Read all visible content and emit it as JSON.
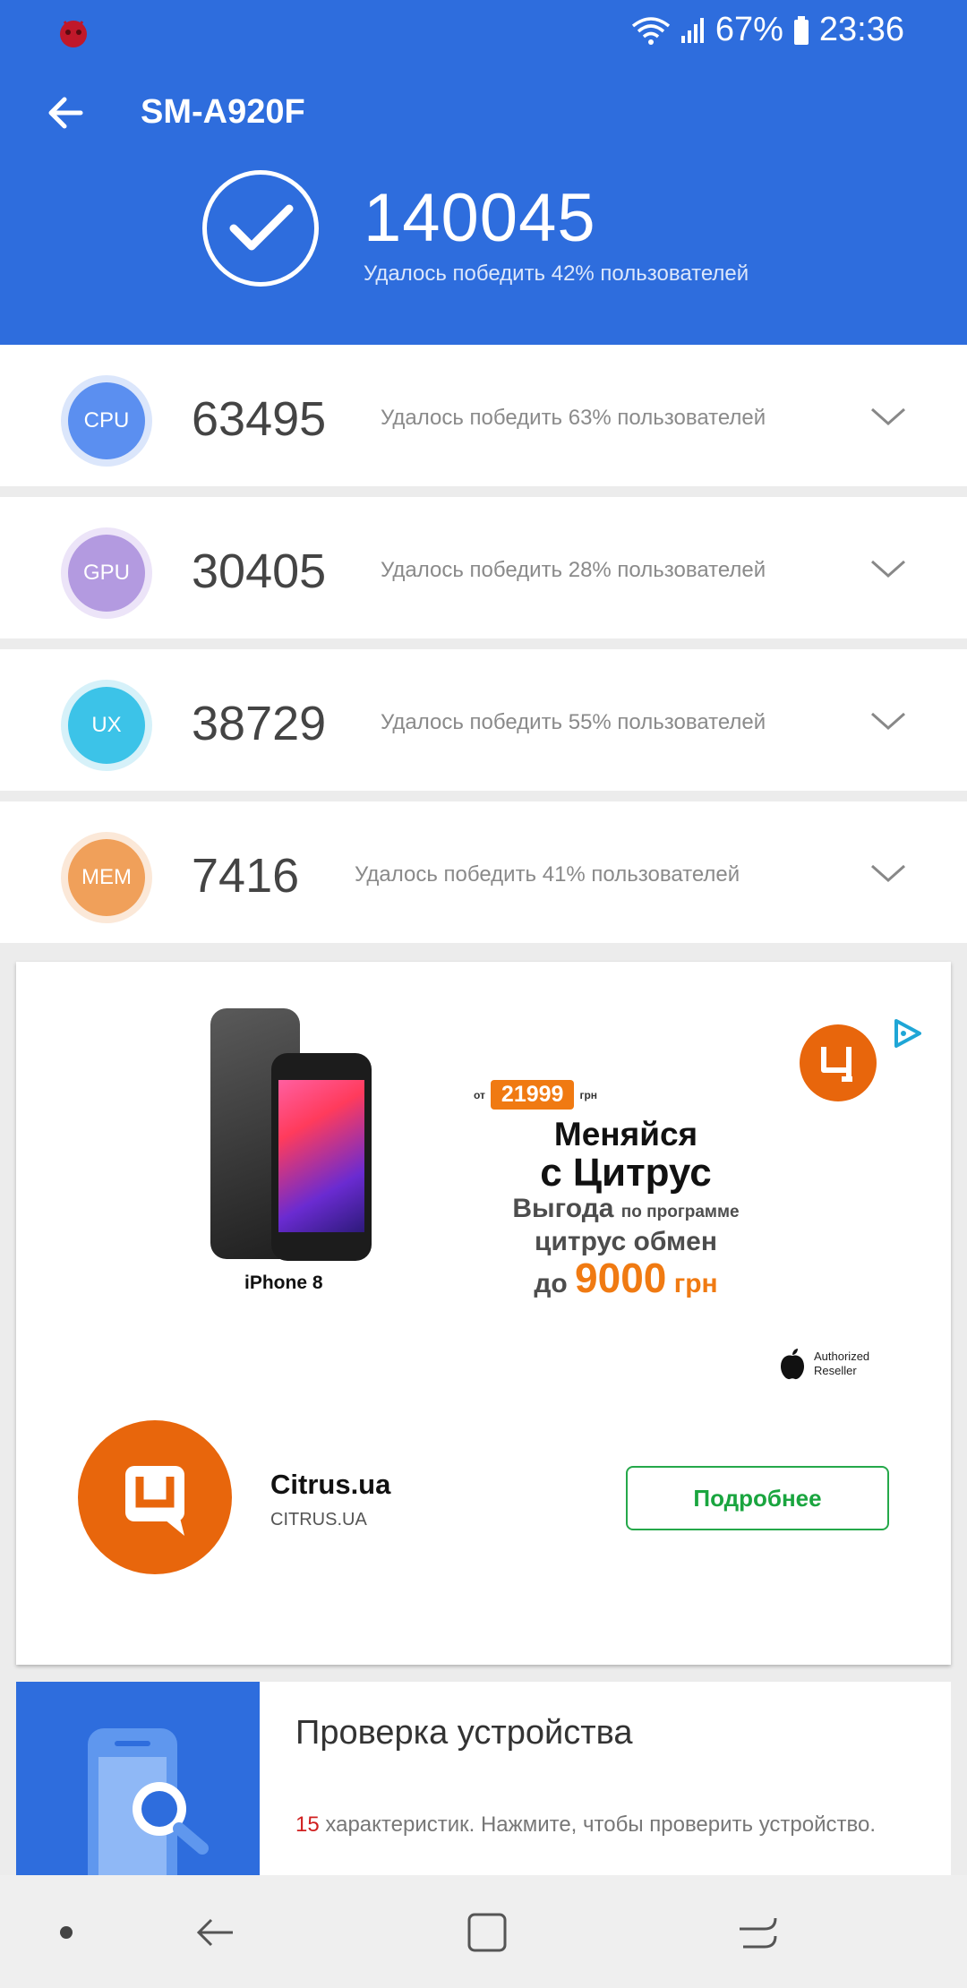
{
  "status_bar": {
    "battery": "67%",
    "time": "23:36"
  },
  "header": {
    "device_name": "SM-A920F",
    "total_score": "140045",
    "total_description": "Удалось победить 42% пользователей"
  },
  "scores": [
    {
      "badge": "CPU",
      "score": "63495",
      "description": "Удалось победить 63% пользователей",
      "color": "#5b8ff0"
    },
    {
      "badge": "GPU",
      "score": "30405",
      "description": "Удалось победить 28% пользователей",
      "color": "#b39ae0"
    },
    {
      "badge": "UX",
      "score": "38729",
      "description": "Удалось победить 55% пользователей",
      "color": "#3cc3e8"
    },
    {
      "badge": "MEM",
      "score": "7416",
      "description": "Удалось победить 41% пользователей",
      "color": "#f0a05a"
    }
  ],
  "ad": {
    "banner": {
      "price_prefix": "от",
      "price": "21999",
      "price_currency": "грн",
      "headline_1": "Меняйся",
      "headline_2": "с Цитрус",
      "line_3a": "Выгода",
      "line_3b": "по программе",
      "line_4": "цитрус обмен",
      "line_5a": "до",
      "line_5b": "9000",
      "line_5c": "грн",
      "product_label": "iPhone 8",
      "reseller_line1": "Authorized",
      "reseller_line2": "Reseller"
    },
    "advertiser_name": "Citrus.ua",
    "advertiser_url": "CITRUS.UA",
    "cta_label": "Подробнее"
  },
  "device_check": {
    "title": "Проверка устройства",
    "count": "15",
    "description": " характеристик. Нажмите, чтобы проверить устройство."
  },
  "colors": {
    "header_blue": "#2e6ddd",
    "citrus_orange": "#e8660c",
    "cta_green": "#1aa53f"
  }
}
